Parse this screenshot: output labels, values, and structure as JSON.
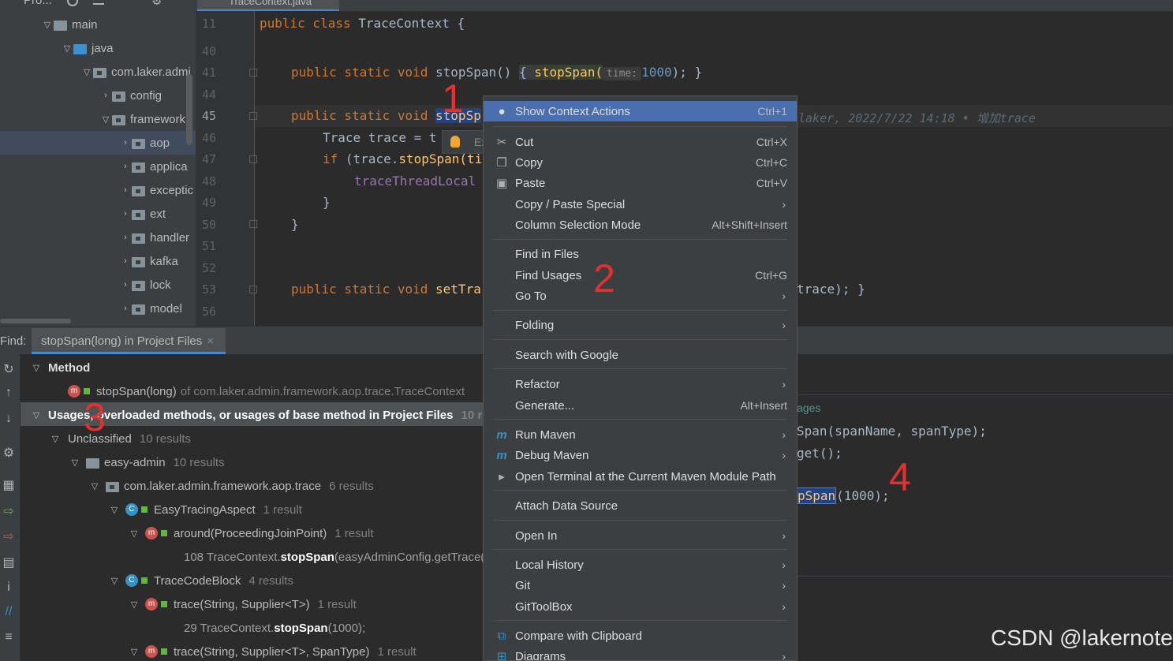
{
  "project": {
    "header_label": "Pro...",
    "items": [
      {
        "label": "main",
        "icon": "folder-icon"
      },
      {
        "label": "java",
        "icon": "source-folder-icon"
      },
      {
        "label": "com.laker.admi",
        "icon": "package-icon"
      },
      {
        "label": "config",
        "icon": "package-icon"
      },
      {
        "label": "framework",
        "icon": "package-icon"
      },
      {
        "label": "aop",
        "icon": "package-icon"
      },
      {
        "label": "applica",
        "icon": "package-icon"
      },
      {
        "label": "exceptic",
        "icon": "package-icon"
      },
      {
        "label": "ext",
        "icon": "package-icon"
      },
      {
        "label": "handler",
        "icon": "package-icon"
      },
      {
        "label": "kafka",
        "icon": "package-icon"
      },
      {
        "label": "lock",
        "icon": "package-icon"
      },
      {
        "label": "model",
        "icon": "package-icon"
      }
    ]
  },
  "editor": {
    "tab_label": "TraceContext.java",
    "line_numbers": [
      "11",
      "40",
      "41",
      "44",
      "45",
      "46",
      "47",
      "48",
      "49",
      "50",
      "51",
      "52",
      "53",
      "56"
    ],
    "blame": "laker, 2022/7/22 14:18 • 增加trace",
    "hint_label": "time:",
    "code": {
      "l11_kw": "public class ",
      "l11_name": "TraceContext {",
      "l41_kw": "public static void ",
      "l41_fn": "stopSpan() ",
      "l41_open": "{ ",
      "l41_call": "stopSpan(",
      "l41_num": "1000",
      "l41_close": "); }",
      "l45_kw": "public static void ",
      "l45_fn": "stopSp",
      "l46_code": "Trace trace = t",
      "l47_kw": "if ",
      "l47_code": "(trace.",
      "l47_call": "stopSpan(ti",
      "l48_code": "traceThreadLocal",
      "l49_code": "}",
      "l50_code": "}",
      "l53_kw": "public static void ",
      "l53_fn": "setTra",
      "l53_tail": "trace); }"
    },
    "bulb_popup_text": "Ex"
  },
  "find": {
    "label": "Find:",
    "tab_label": "stopSpan(long) in Project Files",
    "rows": {
      "method_header": "Method",
      "method_sig": "stopSpan(long)",
      "method_of": "of com.laker.admin.framework.aop.trace.TraceContext",
      "usages_header": "Usages, overloaded methods, or usages of base method in Project Files",
      "usages_count": "10 res",
      "unclassified": "Unclassified",
      "unclassified_count": "10 results",
      "module": "easy-admin",
      "module_count": "10 results",
      "package": "com.laker.admin.framework.aop.trace",
      "package_count": "6 results",
      "class1": "EasyTracingAspect",
      "class1_count": "1 result",
      "method1": "around(ProceedingJoinPoint)",
      "method1_count": "1 result",
      "usage1_pre": "108 TraceContext.",
      "usage1_bold": "stopSpan",
      "usage1_post": "(easyAdminConfig.getTrace().",
      "class2": "TraceCodeBlock",
      "class2_count": "4 results",
      "method2": "trace(String, Supplier<T>)",
      "method2_count": "1 result",
      "usage2_pre": "29 TraceContext.",
      "usage2_bold": "stopSpan",
      "usage2_post": "(1000);",
      "method3": "trace(String, Supplier<T>, SpanType)",
      "method3_count": "1 result"
    }
  },
  "preview": {
    "header": "ages",
    "line1": "Span(spanName, spanType);",
    "line2": "get();",
    "line3_sel": "pSpan",
    "line3_tail": "(1000);"
  },
  "context_menu": {
    "items": [
      {
        "label": "Show Context Actions",
        "shortcut": "Ctrl+1",
        "icon": "lightbulb-icon"
      },
      {
        "label": "Cut",
        "shortcut": "Ctrl+X",
        "icon": "scissors-icon"
      },
      {
        "label": "Copy",
        "shortcut": "Ctrl+C",
        "icon": "copy-icon"
      },
      {
        "label": "Paste",
        "shortcut": "Ctrl+V",
        "icon": "clipboard-icon"
      },
      {
        "label": "Copy / Paste Special",
        "shortcut": ""
      },
      {
        "label": "Column Selection Mode",
        "shortcut": "Alt+Shift+Insert"
      },
      {
        "label": "Find in Files",
        "shortcut": ""
      },
      {
        "label": "Find Usages",
        "shortcut": "Ctrl+G"
      },
      {
        "label": "Go To",
        "shortcut": ""
      },
      {
        "label": "Folding",
        "shortcut": ""
      },
      {
        "label": "Search with Google",
        "shortcut": ""
      },
      {
        "label": "Refactor",
        "shortcut": ""
      },
      {
        "label": "Generate...",
        "shortcut": "Alt+Insert"
      },
      {
        "label": "Run Maven",
        "shortcut": "",
        "icon": "maven-icon"
      },
      {
        "label": "Debug Maven",
        "shortcut": "",
        "icon": "maven-debug-icon"
      },
      {
        "label": "Open Terminal at the Current Maven Module Path",
        "shortcut": "",
        "icon": "terminal-icon"
      },
      {
        "label": "Attach Data Source",
        "shortcut": ""
      },
      {
        "label": "Open In",
        "shortcut": ""
      },
      {
        "label": "Local History",
        "shortcut": ""
      },
      {
        "label": "Git",
        "shortcut": ""
      },
      {
        "label": "GitToolBox",
        "shortcut": ""
      },
      {
        "label": "Compare with Clipboard",
        "shortcut": "",
        "icon": "compare-icon"
      },
      {
        "label": "Diagrams",
        "shortcut": "",
        "icon": "diagram-icon"
      }
    ]
  },
  "annotations": [
    "1",
    "2",
    "3",
    "4"
  ],
  "watermark": "CSDN @lakernote",
  "colors": {
    "accent": "#4b6eaf",
    "annotation": "#e53030"
  }
}
